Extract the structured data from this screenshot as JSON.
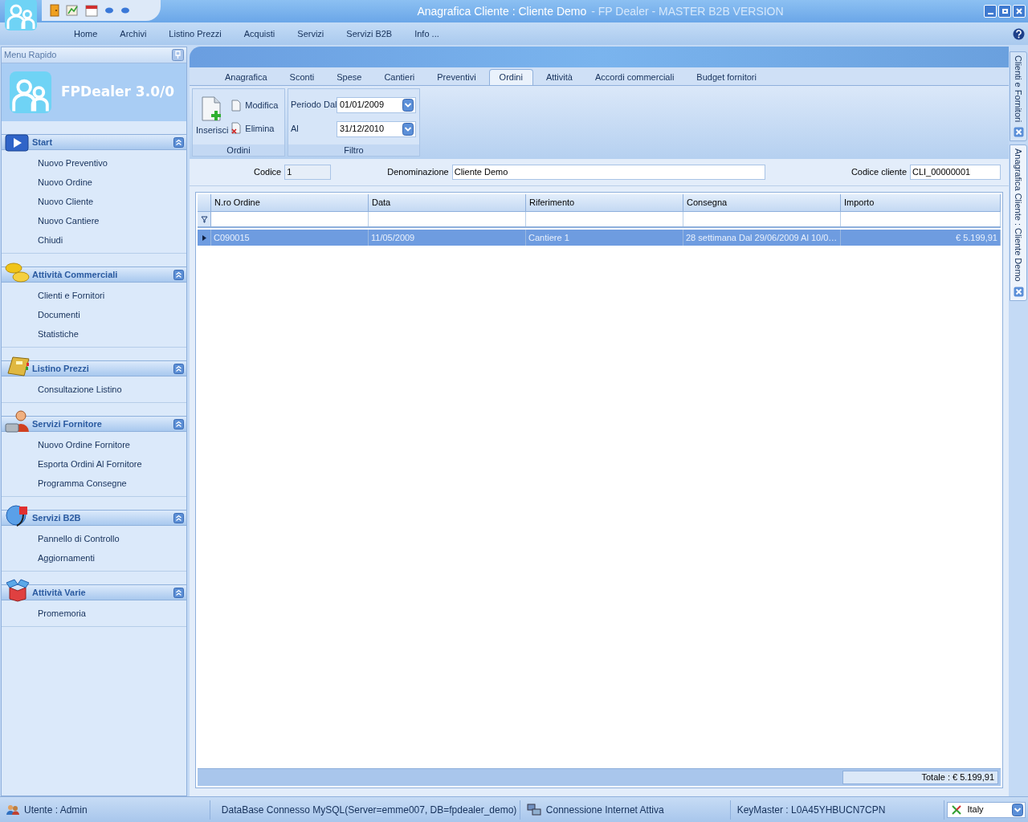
{
  "window": {
    "title": "Anagrafica Cliente : Cliente Demo",
    "subtitle": "- FP Dealer - MASTER B2B VERSION"
  },
  "menu": [
    "Home",
    "Archivi",
    "Listino Prezzi",
    "Acquisti",
    "Servizi",
    "Servizi B2B",
    "Info ..."
  ],
  "sidebar": {
    "header": "Menu Rapido",
    "app_name": "FPDealer 3.0/0",
    "groups": [
      {
        "title": "Start",
        "kind": "play",
        "items": [
          "Nuovo Preventivo",
          "Nuovo Ordine",
          "Nuovo Cliente",
          "Nuovo Cantiere",
          "Chiudi"
        ]
      },
      {
        "title": "Attività Commerciali",
        "kind": "coins",
        "items": [
          "Clienti e Fornitori",
          "Documenti",
          "Statistiche"
        ]
      },
      {
        "title": "Listino Prezzi",
        "kind": "book",
        "items": [
          "Consultazione Listino"
        ]
      },
      {
        "title": "Servizi Fornitore",
        "kind": "person",
        "items": [
          "Nuovo Ordine Fornitore",
          "Esporta Ordini Al Fornitore",
          "Programma Consegne"
        ]
      },
      {
        "title": "Servizi B2B",
        "kind": "plug",
        "items": [
          "Pannello di Controllo",
          "Aggiornamenti"
        ]
      },
      {
        "title": "Attività Varie",
        "kind": "box",
        "items": [
          "Promemoria"
        ]
      }
    ]
  },
  "tabs": [
    {
      "label": "Anagrafica",
      "selected": false
    },
    {
      "label": "Sconti",
      "selected": false
    },
    {
      "label": "Spese",
      "selected": false
    },
    {
      "label": "Cantieri",
      "selected": false
    },
    {
      "label": "Preventivi",
      "selected": false
    },
    {
      "label": "Ordini",
      "selected": true
    },
    {
      "label": "Attività",
      "selected": false
    },
    {
      "label": "Accordi commerciali",
      "selected": false
    },
    {
      "label": "Budget fornitori",
      "selected": false
    }
  ],
  "ribbon": {
    "ordini": {
      "label": "Ordini",
      "insert": "Inserisci",
      "edit": "Modifica",
      "delete": "Elimina"
    },
    "filtro": {
      "label": "Filtro",
      "fields": [
        {
          "label": "Periodo Dal",
          "value": "01/01/2009"
        },
        {
          "label": "Al",
          "value": "31/12/2010"
        }
      ]
    }
  },
  "fields": [
    {
      "label": "Codice",
      "value": "1"
    },
    {
      "label": "Denominazione",
      "value": "Cliente Demo"
    },
    {
      "label": "Codice cliente",
      "value": "CLI_00000001"
    }
  ],
  "table": {
    "columns": [
      "N.ro Ordine",
      "Data",
      "Riferimento",
      "Consegna",
      "Importo"
    ],
    "rows": [
      {
        "cells": [
          "C090015",
          "11/05/2009",
          "Cantiere 1",
          "28 settimana Dal 29/06/2009 Al 10/0…",
          "€ 5.199,91"
        ],
        "selected": true
      }
    ],
    "total": "Totale : € 5.199,91"
  },
  "side_tabs": [
    {
      "label": "Clienti e Fornitori",
      "selected": false
    },
    {
      "label": "Anagrafica Cliente : Cliente Demo",
      "selected": true
    }
  ],
  "status_bar": [
    {
      "kind": "users",
      "text": "Utente : Admin"
    },
    {
      "kind": "database",
      "text": "DataBase Connesso MySQL(Server=emme007, DB=fpdealer_demo)"
    },
    {
      "kind": "network",
      "text": "Connessione Internet Attiva"
    },
    {
      "kind": "key",
      "text": "KeyMaster : L0A45YHBUCN7CPN"
    }
  ],
  "locale": "Italy"
}
